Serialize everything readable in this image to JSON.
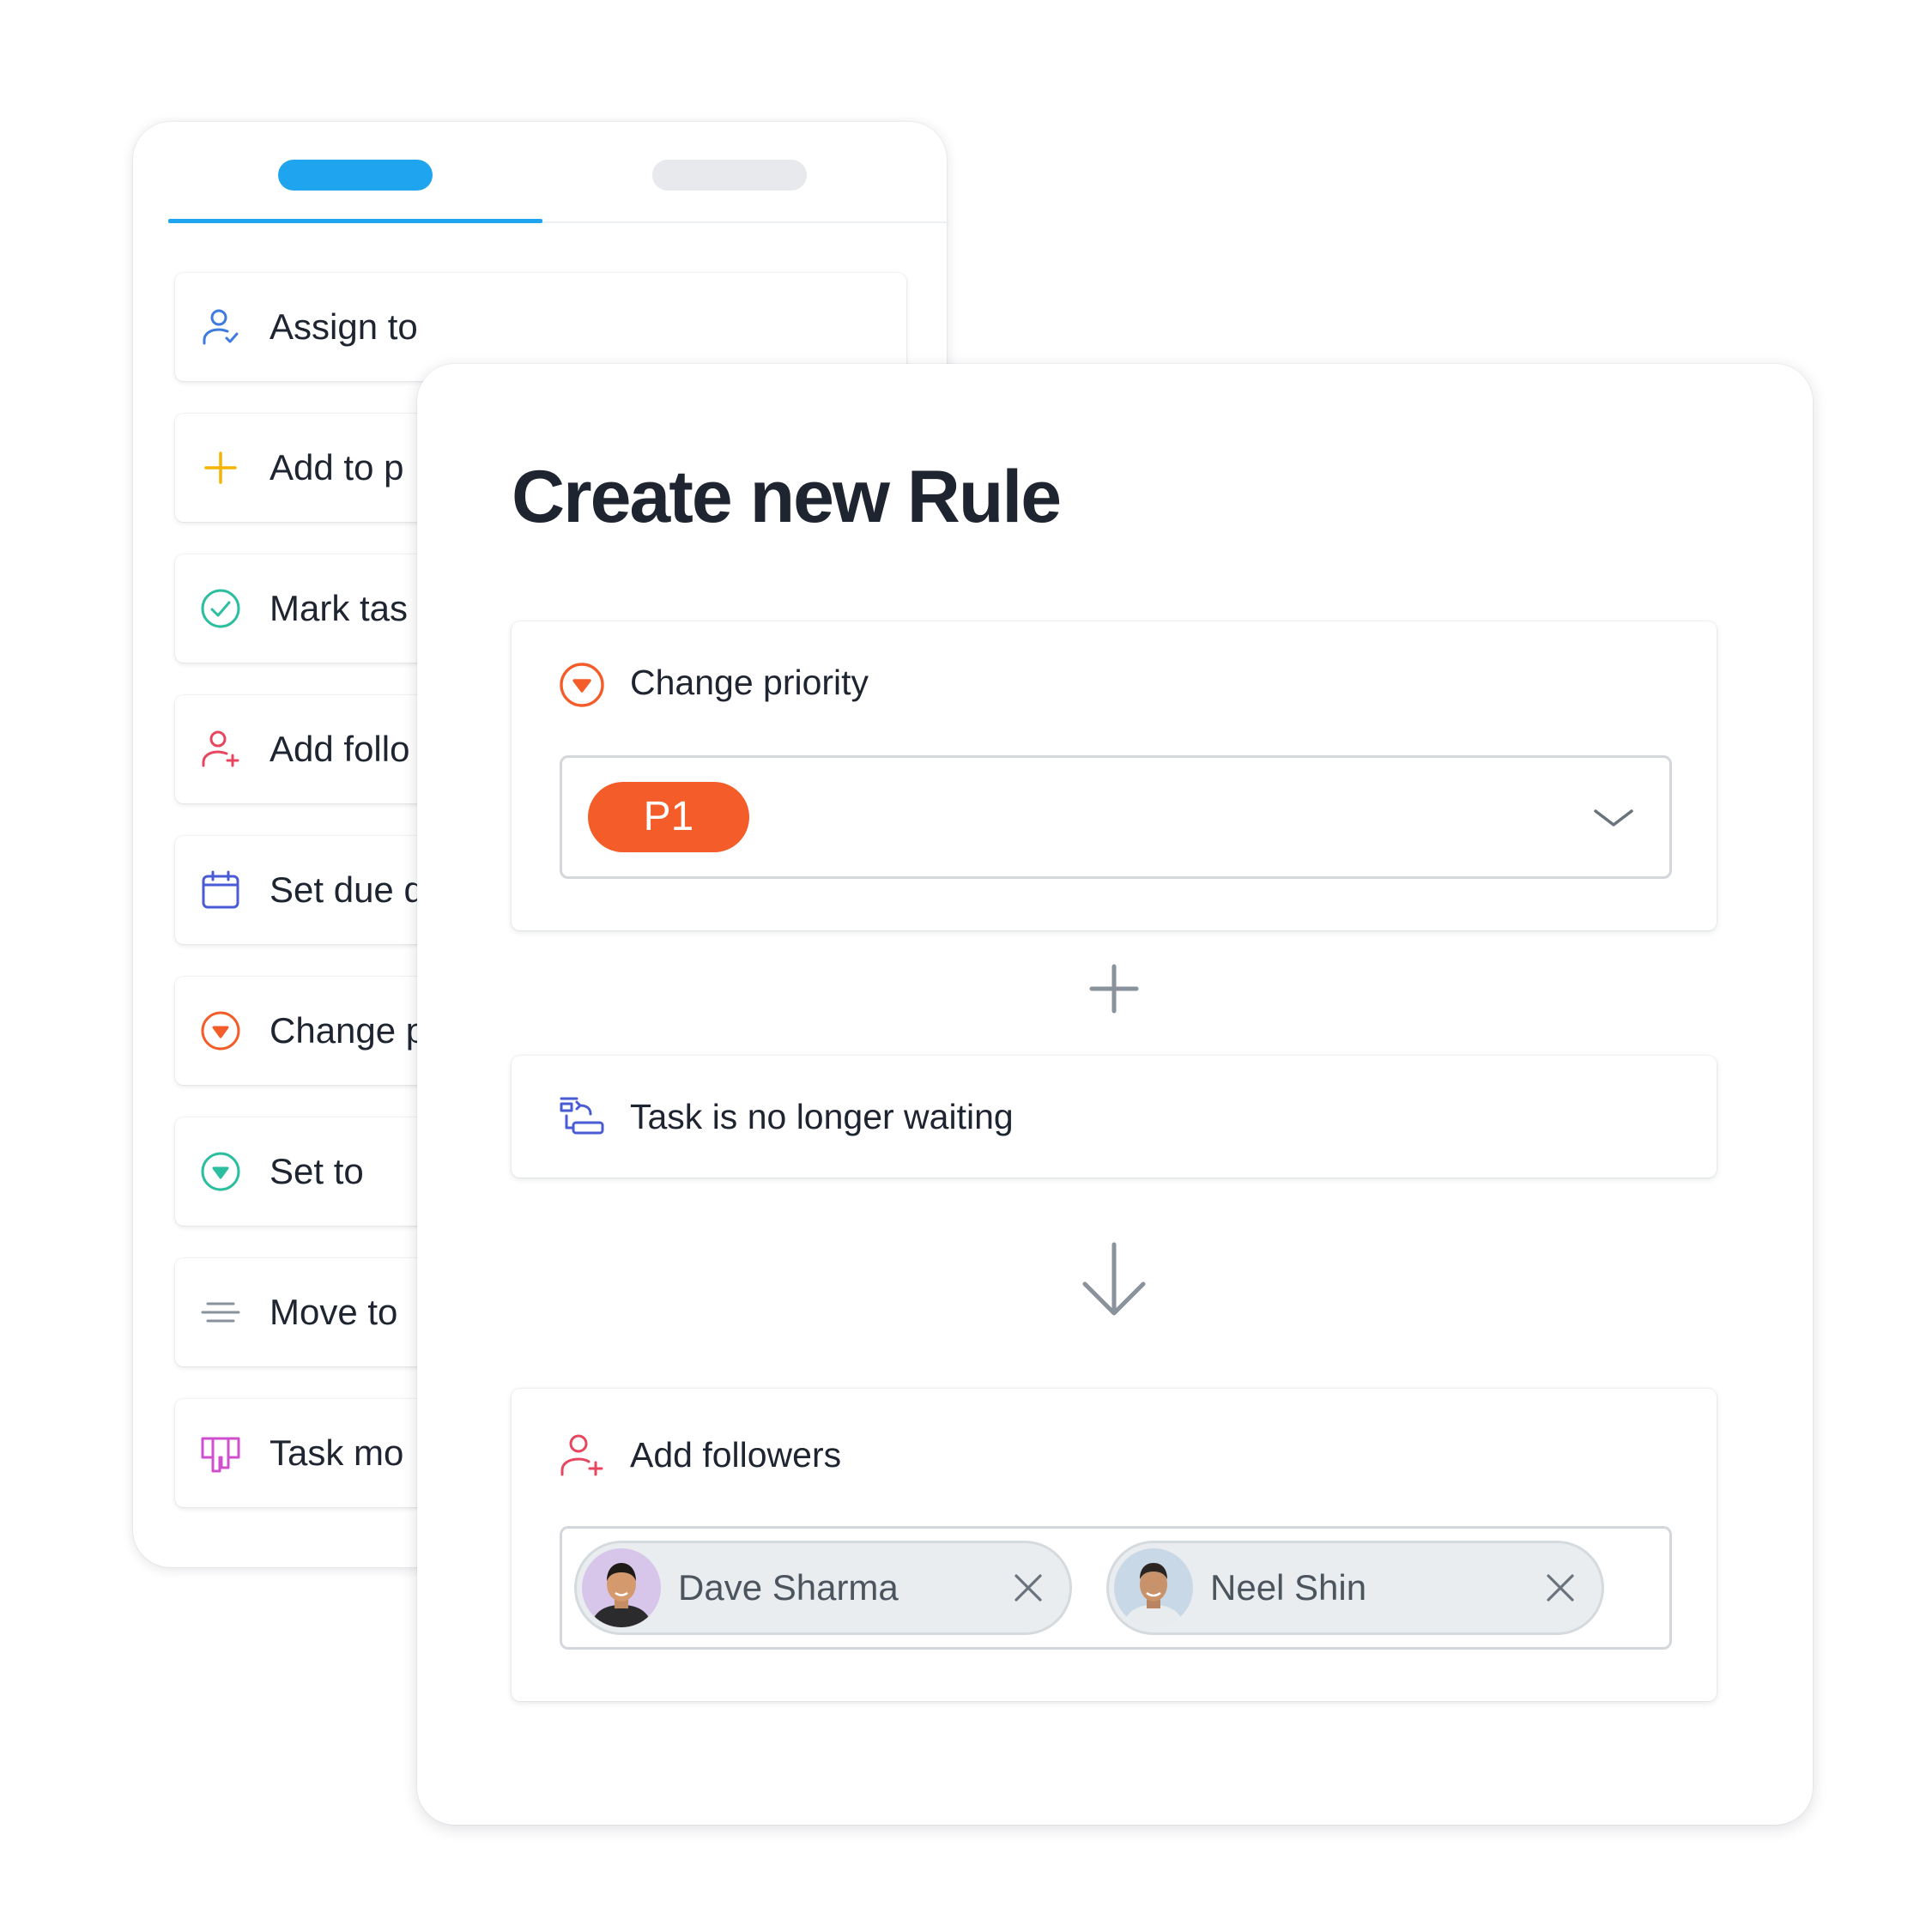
{
  "actions_panel": {
    "tabs": [
      {
        "name": "tab-actions",
        "active": true
      },
      {
        "name": "tab-secondary",
        "active": false
      }
    ],
    "items": [
      {
        "label": "Assign to",
        "icon": "user-check-icon",
        "color": "#3d7be0"
      },
      {
        "label": "Add to p",
        "icon": "plus-icon",
        "color": "#f4b400"
      },
      {
        "label": "Mark tas",
        "icon": "check-circle-icon",
        "color": "#2bbfa0"
      },
      {
        "label": "Add follo",
        "icon": "user-plus-icon",
        "color": "#e8455f"
      },
      {
        "label": "Set due d",
        "icon": "calendar-icon",
        "color": "#4a5bd6"
      },
      {
        "label": "Change p",
        "icon": "priority-down-icon",
        "color": "#f45d29"
      },
      {
        "label": "Set to",
        "icon": "status-down-icon",
        "color": "#2bbfa0"
      },
      {
        "label": "Move to",
        "icon": "lines-icon",
        "color": "#8a929c"
      },
      {
        "label": "Task mo",
        "icon": "board-icon",
        "color": "#d04fcf"
      }
    ]
  },
  "rule_dialog": {
    "title": "Create new Rule",
    "trigger": {
      "label": "Change priority",
      "icon": "priority-down-icon",
      "selected_priority": "P1",
      "priority_color": "#f45d29"
    },
    "condition": {
      "label": "Task is no longer waiting",
      "icon": "waiting-swap-icon"
    },
    "action": {
      "label": "Add followers",
      "icon": "user-plus-icon",
      "followers": [
        {
          "name": "Dave Sharma"
        },
        {
          "name": "Neel Shin"
        }
      ]
    }
  },
  "colors": {
    "accent": "#1fa4ef",
    "priority": "#f45d29",
    "text": "#1f2530",
    "muted": "#8a929c"
  }
}
